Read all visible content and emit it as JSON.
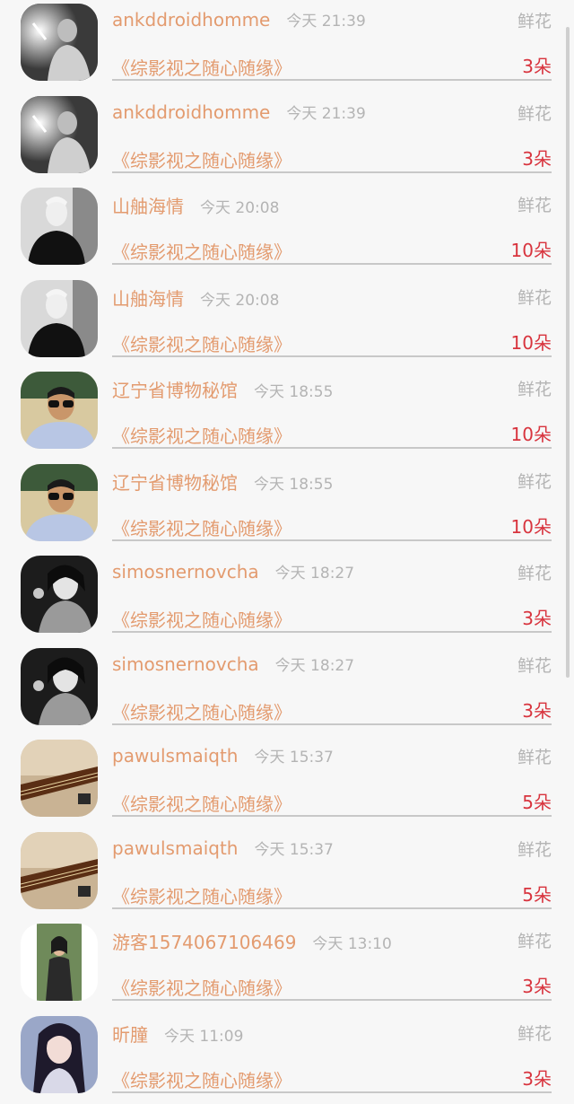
{
  "gift_label": "鲜花",
  "rows": [
    {
      "name": "ankddroidhomme",
      "time": "今天 21:39",
      "book": "《综影视之随心随缘》",
      "count": "3朵",
      "avatar": "bw-glow-figure"
    },
    {
      "name": "ankddroidhomme",
      "time": "今天 21:39",
      "book": "《综影视之随心随缘》",
      "count": "3朵",
      "avatar": "bw-glow-figure"
    },
    {
      "name": "山舳海情",
      "time": "今天 20:08",
      "book": "《综影视之随心随缘》",
      "count": "10朵",
      "avatar": "bw-man-black-shirt"
    },
    {
      "name": "山舳海情",
      "time": "今天 20:08",
      "book": "《综影视之随心随缘》",
      "count": "10朵",
      "avatar": "bw-man-black-shirt"
    },
    {
      "name": "辽宁省博物秘馆",
      "time": "今天 18:55",
      "book": "《综影视之随心随缘》",
      "count": "10朵",
      "avatar": "man-sunglasses"
    },
    {
      "name": "辽宁省博物秘馆",
      "time": "今天 18:55",
      "book": "《综影视之随心随缘》",
      "count": "10朵",
      "avatar": "man-sunglasses"
    },
    {
      "name": "simosnernovcha",
      "time": "今天 18:27",
      "book": "《综影视之随心随缘》",
      "count": "3朵",
      "avatar": "bw-woman-portrait"
    },
    {
      "name": "simosnernovcha",
      "time": "今天 18:27",
      "book": "《综影视之随心随缘》",
      "count": "3朵",
      "avatar": "bw-woman-portrait"
    },
    {
      "name": "pawulsmaiqth",
      "time": "今天 15:37",
      "book": "《综影视之随心随缘》",
      "count": "5朵",
      "avatar": "guqin-instrument"
    },
    {
      "name": "pawulsmaiqth",
      "time": "今天 15:37",
      "book": "《综影视之随心随缘》",
      "count": "5朵",
      "avatar": "guqin-instrument"
    },
    {
      "name": "游客1574067106469",
      "time": "今天 13:10",
      "book": "《综影视之随心随缘》",
      "count": "3朵",
      "avatar": "girl-photo"
    },
    {
      "name": "昕朣",
      "time": "今天 11:09",
      "book": "《综影视之随心随缘》",
      "count": "3朵",
      "avatar": "anime-girl"
    }
  ]
}
